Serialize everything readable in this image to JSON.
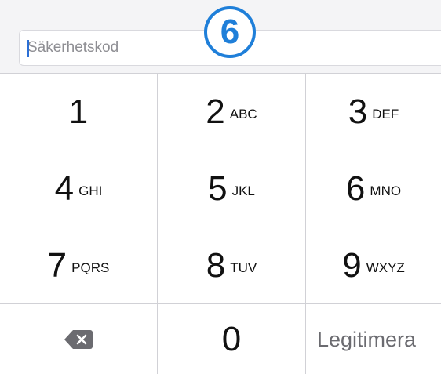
{
  "code_field": {
    "placeholder": "Säkerhetskod",
    "value": ""
  },
  "step_badge": "6",
  "keypad": {
    "keys": [
      {
        "digit": "1",
        "letters": ""
      },
      {
        "digit": "2",
        "letters": "ABC"
      },
      {
        "digit": "3",
        "letters": "DEF"
      },
      {
        "digit": "4",
        "letters": "GHI"
      },
      {
        "digit": "5",
        "letters": "JKL"
      },
      {
        "digit": "6",
        "letters": "MNO"
      },
      {
        "digit": "7",
        "letters": "PQRS"
      },
      {
        "digit": "8",
        "letters": "TUV"
      },
      {
        "digit": "9",
        "letters": "WXYZ"
      },
      {
        "digit": "0",
        "letters": ""
      }
    ],
    "delete_icon": "backspace-icon",
    "action_label": "Legitimera"
  },
  "colors": {
    "accent": "#1f7fd9",
    "caret": "#2b6fd6",
    "divider": "#d1d1d6",
    "backspace": "#6b6b70"
  }
}
